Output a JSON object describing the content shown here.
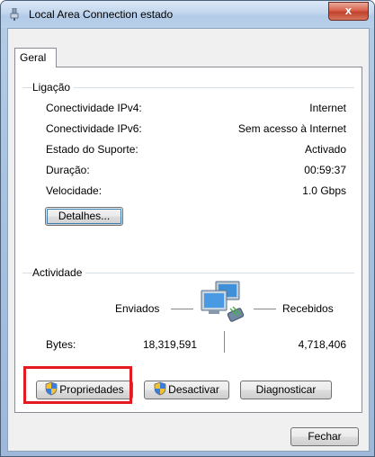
{
  "window": {
    "title": "Local Area Connection estado",
    "close_glyph": "x"
  },
  "tabs": [
    {
      "label": "Geral"
    }
  ],
  "connection": {
    "group_title": "Ligação",
    "rows": [
      {
        "label": "Conectividade IPv4:",
        "value": "Internet"
      },
      {
        "label": "Conectividade IPv6:",
        "value": "Sem acesso à Internet"
      },
      {
        "label": "Estado do Suporte:",
        "value": "Activado"
      },
      {
        "label": "Duração:",
        "value": "00:59:37"
      },
      {
        "label": "Velocidade:",
        "value": "1.0 Gbps"
      }
    ],
    "details_button": "Detalhes..."
  },
  "activity": {
    "group_title": "Actividade",
    "sent_label": "Enviados",
    "received_label": "Recebidos",
    "bytes_label": "Bytes:",
    "bytes_sent": "18,319,591",
    "bytes_received": "4,718,406"
  },
  "actions": {
    "properties": "Propriedades",
    "disable": "Desactivar",
    "diagnose": "Diagnosticar"
  },
  "footer": {
    "close": "Fechar"
  },
  "colors": {
    "highlight": "#e21b23",
    "close_button": "#c0422d",
    "title_gradient": "#c3d6ed"
  }
}
